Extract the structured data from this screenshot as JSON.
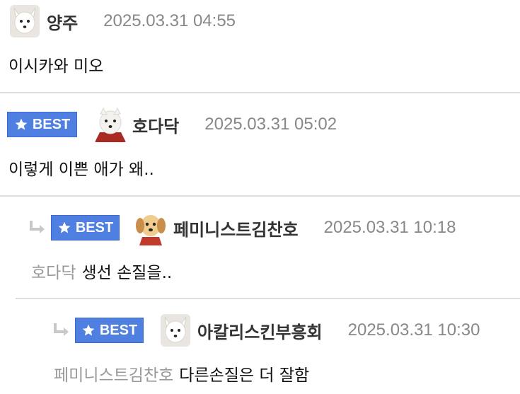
{
  "comments": [
    {
      "best": false,
      "reply": false,
      "avatar": "white-fox-avatar",
      "nickname": "양주",
      "time": "2025.03.31 04:55",
      "mention": "",
      "text": "이시카와 미오"
    },
    {
      "best": true,
      "best_label": "BEST",
      "reply": false,
      "avatar": "samoyed-dog-avatar",
      "nickname": "호다닥",
      "time": "2025.03.31 05:02",
      "mention": "",
      "text": "이렇게 이쁜 애가 왜.."
    },
    {
      "best": true,
      "best_label": "BEST",
      "reply": true,
      "avatar": "puppy-avatar",
      "nickname": "페미니스트김찬호",
      "time": "2025.03.31 10:18",
      "mention": "호다닥",
      "text": "생선 손질을.."
    },
    {
      "best": true,
      "best_label": "BEST",
      "reply": true,
      "avatar": "white-fox-avatar",
      "nickname": "아칼리스킨부흥회",
      "time": "2025.03.31 10:30",
      "mention": "페미니스트김찬호",
      "text": "다른손질은 더 잘함"
    }
  ],
  "colors": {
    "best_badge": "#4f7fe0",
    "reply_arrow": "#c8c8c8",
    "mention": "#999999"
  }
}
